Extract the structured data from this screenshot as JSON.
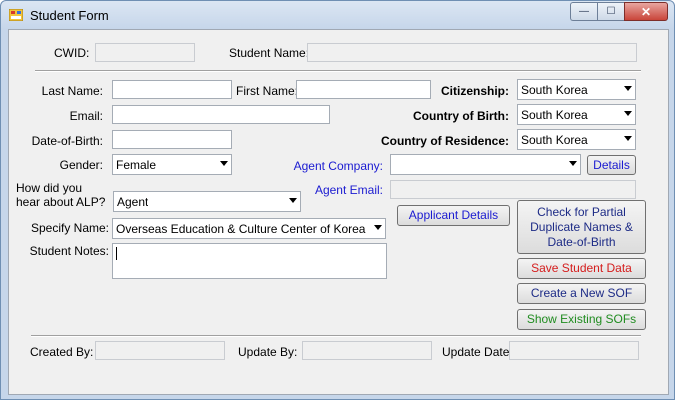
{
  "window": {
    "title": "Student Form"
  },
  "caption": {
    "minimize": "—",
    "maximize": "☐",
    "close": "✕"
  },
  "labels": {
    "cwid": "CWID:",
    "student_name": "Student Name:",
    "last_name": "Last Name:",
    "first_name": "First Name:",
    "email": "Email:",
    "dob": "Date-of-Birth:",
    "gender": "Gender:",
    "hear_about": "How did you\nhear about ALP?",
    "specify_name": "Specify Name:",
    "student_notes": "Student Notes:",
    "citizenship": "Citizenship:",
    "country_birth": "Country of Birth:",
    "country_residence": "Country of Residence:",
    "agent_company": "Agent Company:",
    "agent_email": "Agent Email:",
    "created_by": "Created By:",
    "update_by": "Update By:",
    "update_date": "Update Date:"
  },
  "values": {
    "cwid": "",
    "student_name": "",
    "last_name": "",
    "first_name": "",
    "email": "",
    "dob": "",
    "gender": "Female",
    "hear_about": "Agent",
    "specify_name": "Overseas Education & Culture Center of Korea",
    "student_notes": "",
    "citizenship": "South Korea",
    "country_birth": "South Korea",
    "country_residence": "South Korea",
    "agent_company": "",
    "agent_email": "",
    "created_by": "",
    "update_by": "",
    "update_date": ""
  },
  "buttons": {
    "details": "Details",
    "applicant_details": "Applicant Details",
    "check_duplicates": "Check for Partial Duplicate Names & Date-of-Birth",
    "save": "Save Student Data",
    "new_sof": "Create a New SOF",
    "show_sofs": "Show Existing SOFs"
  },
  "colors": {
    "label_blue": "#1b1bd1",
    "save_red": "#d51d1d",
    "show_green": "#208c20",
    "new_sof_navy": "#1d2b86"
  }
}
